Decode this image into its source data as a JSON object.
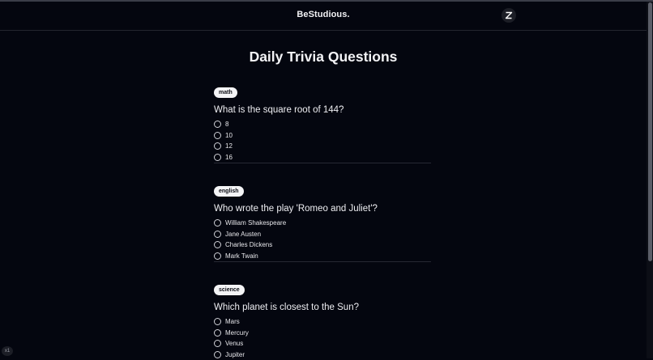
{
  "header": {
    "brand": "BeStudious.",
    "logo_icon": "x-logo-icon"
  },
  "page": {
    "title": "Daily Trivia Questions"
  },
  "questions": [
    {
      "tag": "math",
      "text": "What is the square root of 144?",
      "options": [
        "8",
        "10",
        "12",
        "16"
      ]
    },
    {
      "tag": "english",
      "text": "Who wrote the play 'Romeo and Juliet'?",
      "options": [
        "William Shakespeare",
        "Jane Austen",
        "Charles Dickens",
        "Mark Twain"
      ]
    },
    {
      "tag": "science",
      "text": "Which planet is closest to the Sun?",
      "options": [
        "Mars",
        "Mercury",
        "Venus",
        "Jupiter"
      ]
    }
  ],
  "zoom_badge": "x1",
  "colors": {
    "background": "#04060f",
    "tag_background": "#f4f4f6",
    "divider": "#262833"
  }
}
